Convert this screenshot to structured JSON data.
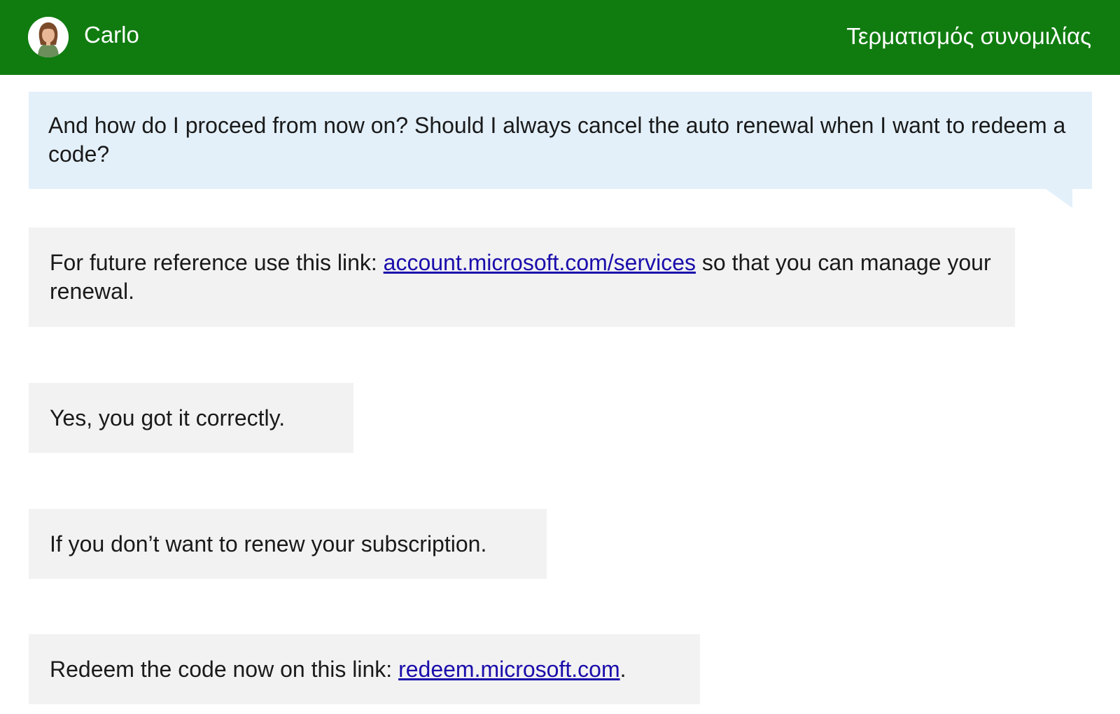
{
  "header": {
    "agent_name": "Carlo",
    "end_chat_label": "Τερματισμός συνομιλίας",
    "background_color": "#107c10",
    "avatar_icon": "agent-avatar-icon"
  },
  "messages": {
    "user_1": {
      "text": "And how do I proceed from now on? Should I always cancel the auto renewal when I want to redeem a code?"
    },
    "agent_1": {
      "before": "For future reference use this link: ",
      "link": "account.microsoft.com/services",
      "after": " so that you can manage your renewal."
    },
    "agent_2": {
      "text": "Yes, you got it correctly."
    },
    "agent_3": {
      "text": "If you don’t want to renew your subscription."
    },
    "agent_4": {
      "before": "Redeem the code now on this link: ",
      "link": "redeem.microsoft.com",
      "after": "."
    }
  },
  "colors": {
    "user_bubble": "#e3f0fa",
    "agent_bubble": "#f2f2f2",
    "link": "#1a0dab"
  }
}
